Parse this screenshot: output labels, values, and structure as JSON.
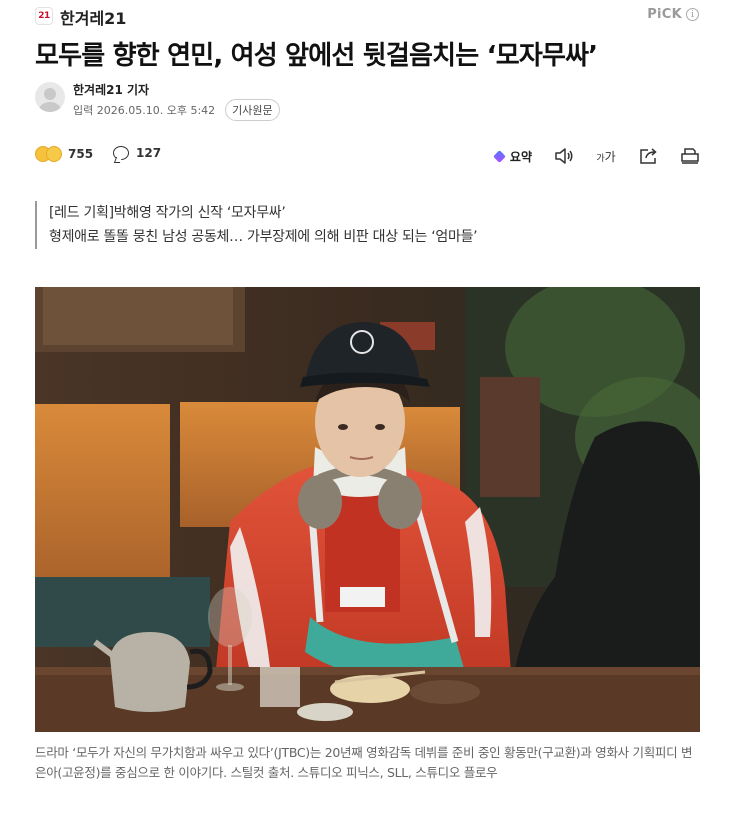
{
  "press": {
    "logo_text": "21",
    "name": "한겨레21"
  },
  "pick": {
    "label": "PiCK",
    "info_glyph": "i"
  },
  "article": {
    "headline": "모두를 향한 연민, 여성 앞에선 뒷걸음치는 ‘모자무싸’",
    "reporter": "한겨레21 기자",
    "date": "입력 2026.05.10. 오후 5:42",
    "source_button": "기사원문",
    "subheads": [
      "[레드 기획]박해영 작가의 신작 ‘모자무싸’",
      "형제애로 똘똘 뭉친 남성 공동체… 가부장제에 의해 비판 대상 되는 ‘엄마들’"
    ],
    "caption": "드라마 ‘모두가 자신의 무가치함과 싸우고 있다’(JTBC)는 20년째 영화감독 데뷔를 준비 중인 황동만(구교환)과 영화사 기획피디 변은아(고윤정)를 중심으로 한 이야기다. 스틸컷 출처. 스튜디오 피닉스, SLL, 스튜디오 플로우"
  },
  "actions": {
    "reaction_count": "755",
    "comment_count": "127",
    "summary_label": "요약",
    "font_size_label_small": "가",
    "font_size_label_large": "가",
    "icons": [
      "reaction-emoji-icon",
      "comment-icon",
      "ai-summary-icon",
      "audio-icon",
      "font-size-icon",
      "share-icon",
      "print-icon"
    ]
  },
  "colors": {
    "brand_red": "#c8102e",
    "jacket_red": "#d9402a",
    "sling_teal": "#3fa99a",
    "wall_orange": "#d98a3a"
  }
}
